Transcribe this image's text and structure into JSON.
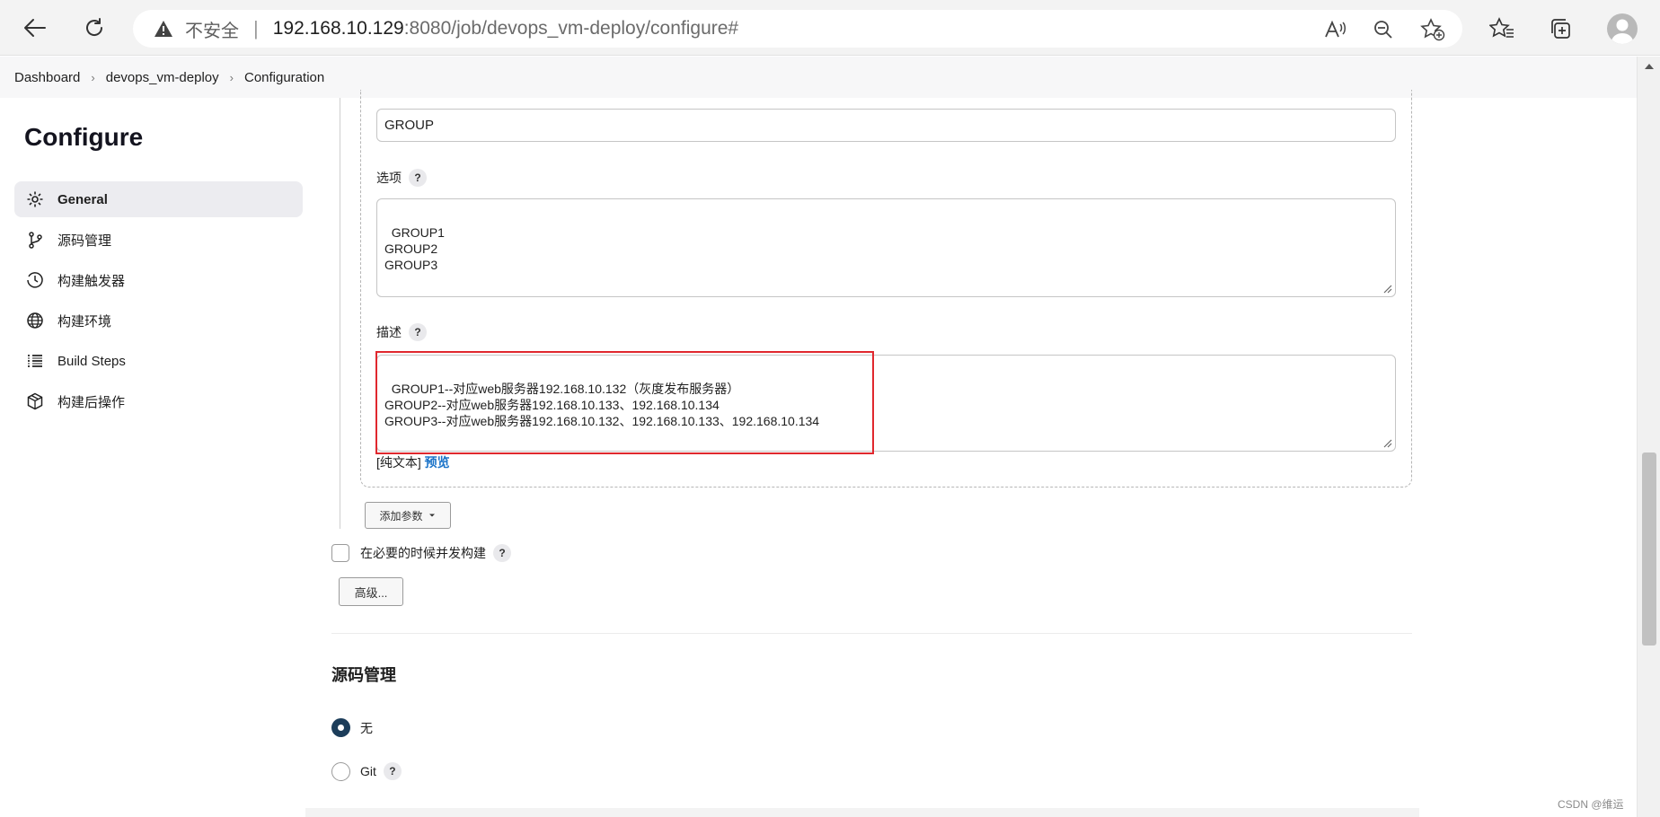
{
  "browser": {
    "insecure_label": "不安全",
    "url_host": "192.168.10.129",
    "url_rest": ":8080/job/devops_vm-deploy/configure#"
  },
  "breadcrumb": {
    "items": [
      "Dashboard",
      "devops_vm-deploy",
      "Configuration"
    ]
  },
  "sidebar": {
    "title": "Configure",
    "items": [
      {
        "label": "General",
        "icon": "gear-icon"
      },
      {
        "label": "源码管理",
        "icon": "branch-icon"
      },
      {
        "label": "构建触发器",
        "icon": "clock-icon"
      },
      {
        "label": "构建环境",
        "icon": "globe-icon"
      },
      {
        "label": "Build Steps",
        "icon": "list-icon"
      },
      {
        "label": "构建后操作",
        "icon": "package-icon"
      }
    ]
  },
  "param": {
    "name_value": "GROUP",
    "options_label": "选项",
    "options_value": "GROUP1\nGROUP2\nGROUP3",
    "desc_label": "描述",
    "desc_value": "GROUP1--对应web服务器192.168.10.132（灰度发布服务器）\nGROUP2--对应web服务器192.168.10.133、192.168.10.134\nGROUP3--对应web服务器192.168.10.132、192.168.10.133、192.168.10.134",
    "plain_text": "[纯文本]",
    "preview": "预览",
    "help": "?"
  },
  "actions": {
    "add_param": "添加参数",
    "concurrent_label": "在必要的时候并发构建",
    "advanced": "高级..."
  },
  "scm": {
    "title": "源码管理",
    "option_none": "无",
    "option_git": "Git"
  },
  "watermark": "CSDN @维运"
}
